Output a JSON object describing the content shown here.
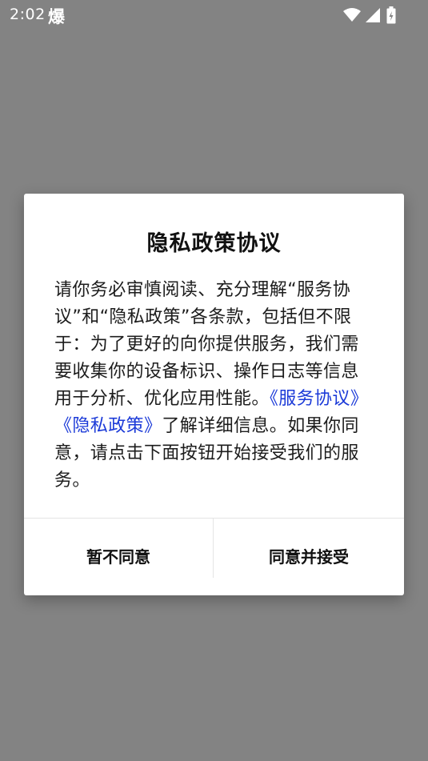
{
  "status_bar": {
    "time": "2:02",
    "notification_glyph": "爆",
    "icons": [
      "wifi-icon",
      "signal-icon",
      "battery-icon"
    ],
    "text_color": "#ffffff"
  },
  "dialog": {
    "title": "隐私政策协议",
    "body_text_1": "请你务必审慎阅读、充分理解“服务协议”和“隐私政策”各条款，包括但不限于：为了更好的向你提供服务，我们需要收集你的设备标识、操作日志等信息用于分析、优化应用性能。",
    "link_service": "《服务协议》",
    "link_privacy": "《隐私政策》",
    "body_text_2": "了解详细信息。如果你同意，请点击下面按钮开始接受我们的服务。",
    "decline_label": "暂不同意",
    "accept_label": "同意并接受",
    "link_color": "#1b3ad8"
  },
  "colors": {
    "overlay_background": "#838383",
    "dialog_background": "#ffffff"
  }
}
